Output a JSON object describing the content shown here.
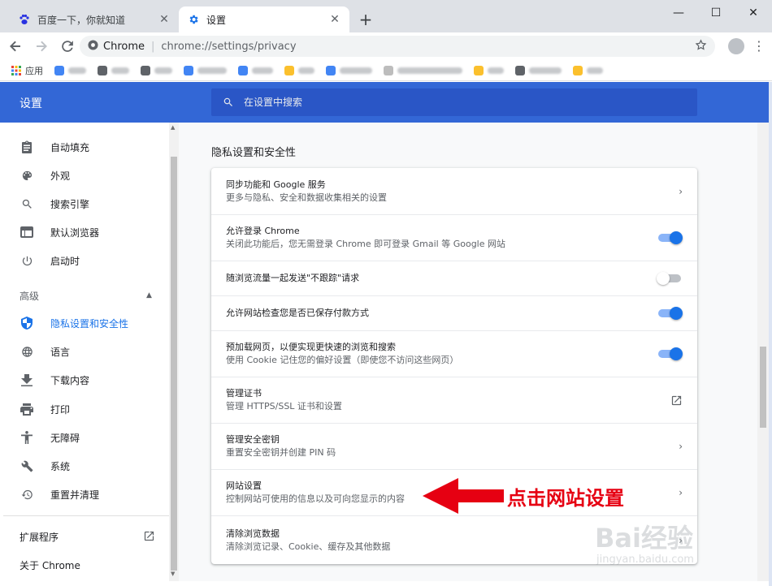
{
  "tabs": [
    {
      "title": "百度一下，你就知道",
      "active": false,
      "favicon": "baidu-paw-icon"
    },
    {
      "title": "设置",
      "active": true,
      "favicon": "gear-icon"
    }
  ],
  "window_controls": {
    "minimize": "—",
    "maximize": "☐",
    "close": "✕"
  },
  "omnibox": {
    "scheme_label": "Chrome",
    "separator": "|",
    "url": "chrome://settings/privacy"
  },
  "bookmarks": [
    {
      "label": "应用",
      "color": "#ea4335"
    }
  ],
  "settings": {
    "brand": "设置",
    "search_placeholder": "在设置中搜索"
  },
  "sidebar": {
    "items": [
      {
        "label": "自动填充",
        "icon": "clipboard-icon"
      },
      {
        "label": "外观",
        "icon": "palette-icon"
      },
      {
        "label": "搜索引擎",
        "icon": "search-icon"
      },
      {
        "label": "默认浏览器",
        "icon": "browser-window-icon"
      },
      {
        "label": "启动时",
        "icon": "power-icon"
      }
    ],
    "advanced_label": "高级",
    "advanced_items": [
      {
        "label": "隐私设置和安全性",
        "icon": "shield-icon",
        "active": true
      },
      {
        "label": "语言",
        "icon": "globe-icon"
      },
      {
        "label": "下载内容",
        "icon": "download-icon"
      },
      {
        "label": "打印",
        "icon": "printer-icon"
      },
      {
        "label": "无障碍",
        "icon": "accessibility-icon"
      },
      {
        "label": "系统",
        "icon": "wrench-icon"
      },
      {
        "label": "重置并清理",
        "icon": "restore-icon"
      }
    ],
    "extensions_label": "扩展程序",
    "about_label": "关于 Chrome"
  },
  "main": {
    "section_title": "隐私设置和安全性",
    "rows": [
      {
        "title": "同步功能和 Google 服务",
        "subtitle": "更多与隐私、安全和数据收集相关的设置",
        "action": "chevron"
      },
      {
        "title": "允许登录 Chrome",
        "subtitle": "关闭此功能后，您无需登录 Chrome 即可登录 Gmail 等 Google 网站",
        "action": "toggle",
        "on": true
      },
      {
        "title": "随浏览流量一起发送\"不跟踪\"请求",
        "subtitle": "",
        "action": "toggle",
        "on": false
      },
      {
        "title": "允许网站检查您是否已保存付款方式",
        "subtitle": "",
        "action": "toggle",
        "on": true
      },
      {
        "title": "预加载网页，以便实现更快速的浏览和搜索",
        "subtitle": "使用 Cookie 记住您的偏好设置（即使您不访问这些网页）",
        "action": "toggle",
        "on": true
      },
      {
        "title": "管理证书",
        "subtitle": "管理 HTTPS/SSL 证书和设置",
        "action": "external"
      },
      {
        "title": "管理安全密钥",
        "subtitle": "重置安全密钥并创建 PIN 码",
        "action": "chevron"
      },
      {
        "title": "网站设置",
        "subtitle": "控制网站可使用的信息以及可向您显示的内容",
        "action": "chevron"
      },
      {
        "title": "清除浏览数据",
        "subtitle": "清除浏览记录、Cookie、缓存及其他数据",
        "action": "chevron"
      }
    ]
  },
  "annotation": {
    "text": "点击网站设置",
    "color": "#e60012"
  },
  "watermark": {
    "brand": "Bai经验",
    "domain": "jingyan.baidu.com"
  },
  "colors": {
    "header_blue": "#3367d6",
    "accent": "#1a73e8"
  }
}
